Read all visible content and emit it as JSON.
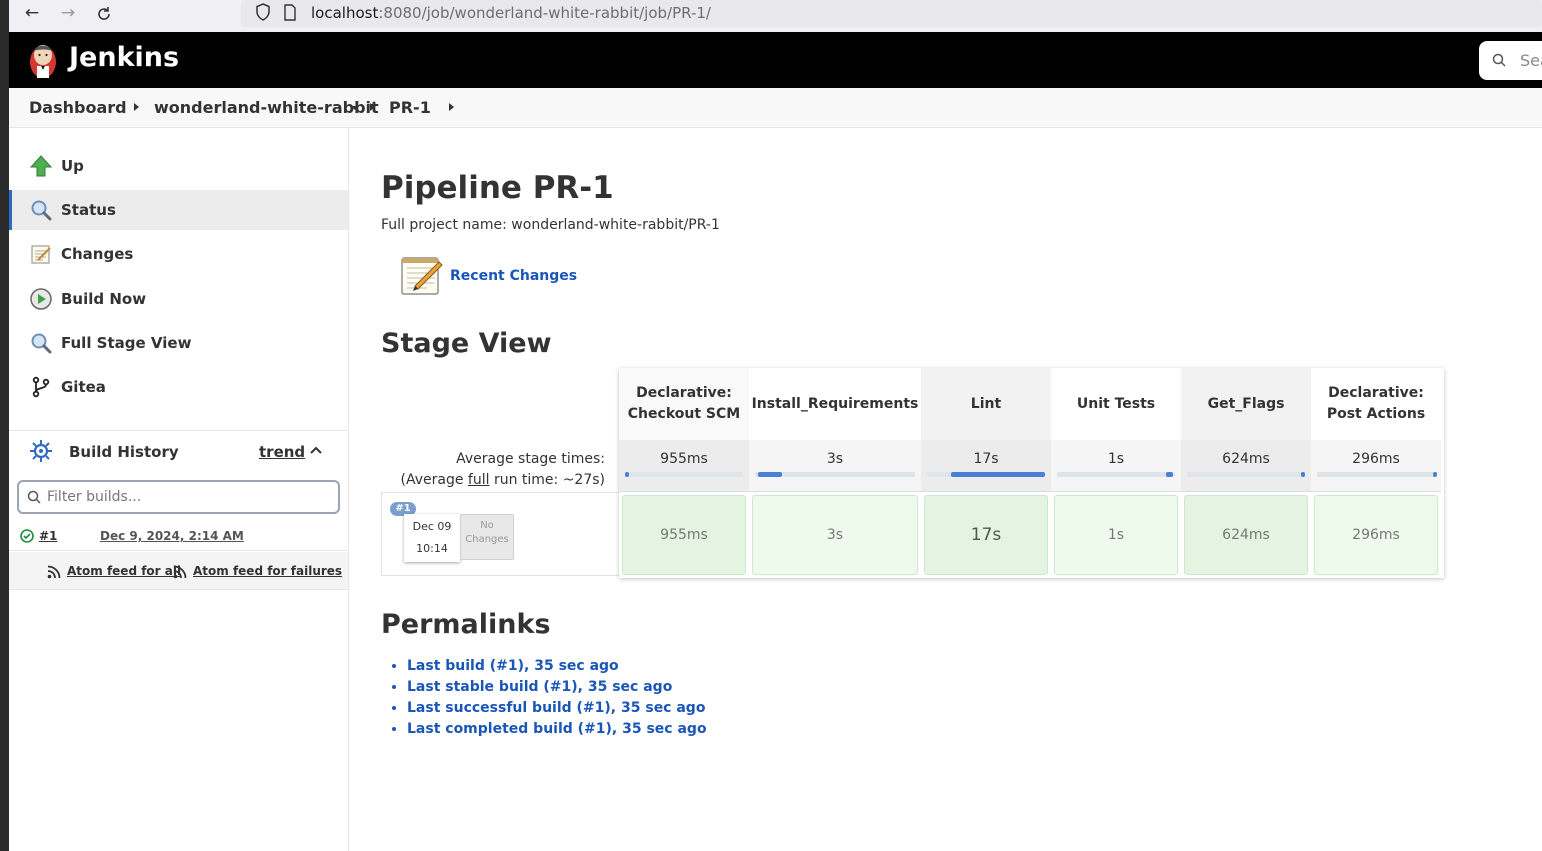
{
  "browser": {
    "url_host": "localhost",
    "url_rest": ":8080/job/wonderland-white-rabbit/job/PR-1/"
  },
  "header": {
    "title": "Jenkins",
    "search_placeholder": "Sea"
  },
  "breadcrumb": {
    "items": [
      "Dashboard",
      "wonderland-white-rabbit",
      "PR-1"
    ]
  },
  "sidebar": {
    "items": [
      {
        "label": "Up",
        "icon": "up-arrow-icon"
      },
      {
        "label": "Status",
        "icon": "magnifier-icon"
      },
      {
        "label": "Changes",
        "icon": "notepad-icon"
      },
      {
        "label": "Build Now",
        "icon": "clock-play-icon"
      },
      {
        "label": "Full Stage View",
        "icon": "magnifier-icon"
      },
      {
        "label": "Gitea",
        "icon": "git-branch-icon"
      }
    ],
    "build_history": {
      "title": "Build History",
      "trend": "trend",
      "filter_placeholder": "Filter builds...",
      "builds": [
        {
          "number": "#1",
          "date": "Dec 9, 2024, 2:14 AM",
          "status": "success"
        }
      ],
      "feed_all": "Atom feed for all",
      "feed_failures": "Atom feed for failures"
    }
  },
  "main": {
    "title": "Pipeline PR-1",
    "full_name": "Full project name: wonderland-white-rabbit/PR-1",
    "recent_changes": "Recent Changes",
    "stage_view_title": "Stage View",
    "avg_label_1": "Average stage times:",
    "avg_label_2_pre": "(Average ",
    "avg_label_2_link": "full",
    "avg_label_2_post": " run time: ~27s)",
    "stages": [
      {
        "name_1": "Declarative:",
        "name_2": "Checkout SCM",
        "avg": "955ms",
        "cell": "955ms",
        "bar_start": 0.0,
        "bar_frac": 0.02
      },
      {
        "name_1": "Install_Requirements",
        "name_2": "",
        "avg": "3s",
        "cell": "3s",
        "bar_start": 0.02,
        "bar_frac": 0.15
      },
      {
        "name_1": "Lint",
        "name_2": "",
        "avg": "17s",
        "cell": "17s",
        "bar_start": 0.2,
        "bar_frac": 0.8
      },
      {
        "name_1": "Unit Tests",
        "name_2": "",
        "avg": "1s",
        "cell": "1s",
        "bar_start": 0.92,
        "bar_frac": 0.06
      },
      {
        "name_1": "Get_Flags",
        "name_2": "",
        "avg": "624ms",
        "cell": "624ms",
        "bar_start": 0.97,
        "bar_frac": 0.02
      },
      {
        "name_1": "Declarative:",
        "name_2": "Post Actions",
        "avg": "296ms",
        "cell": "296ms",
        "bar_start": 0.98,
        "bar_frac": 0.01
      }
    ],
    "run": {
      "badge": "#1",
      "date": "Dec 09",
      "time": "10:14",
      "changes_1": "No",
      "changes_2": "Changes"
    },
    "permalinks_title": "Permalinks",
    "permalinks": [
      "Last build (#1), 35 sec ago",
      "Last stable build (#1), 35 sec ago",
      "Last successful build (#1), 35 sec ago",
      "Last completed build (#1), 35 sec ago"
    ]
  },
  "colors": {
    "link": "#1a56b8",
    "stage_success": "#e3f5e1",
    "bar": "#4a7fd6"
  }
}
